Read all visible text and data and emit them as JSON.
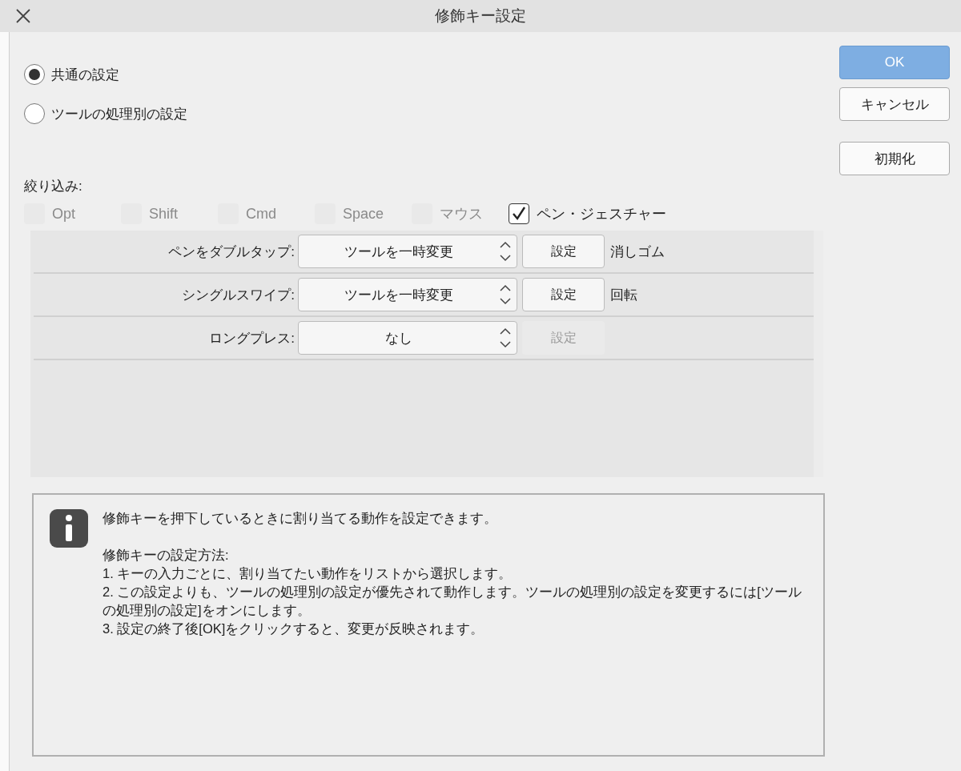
{
  "window": {
    "title": "修飾キー設定"
  },
  "modes": [
    {
      "label": "共通の設定",
      "selected": true
    },
    {
      "label": "ツールの処理別の設定",
      "selected": false
    }
  ],
  "filter_label": "絞り込み:",
  "filters": [
    {
      "label": "Opt",
      "checked": false,
      "disabled": true
    },
    {
      "label": "Shift",
      "checked": false,
      "disabled": true
    },
    {
      "label": "Cmd",
      "checked": false,
      "disabled": true
    },
    {
      "label": "Space",
      "checked": false,
      "disabled": true
    },
    {
      "label": "マウス",
      "checked": false,
      "disabled": true
    },
    {
      "label": "ペン・ジェスチャー",
      "checked": true,
      "disabled": false
    }
  ],
  "rows": [
    {
      "label": "ペンをダブルタップ:",
      "action": "ツールを一時変更",
      "button": "設定",
      "button_disabled": false,
      "result": "消しゴム"
    },
    {
      "label": "シングルスワイプ:",
      "action": "ツールを一時変更",
      "button": "設定",
      "button_disabled": false,
      "result": "回転"
    },
    {
      "label": "ロングプレス:",
      "action": "なし",
      "button": "設定",
      "button_disabled": true
    }
  ],
  "info": [
    "修飾キーを押下しているときに割り当てる動作を設定できます。",
    "修飾キーの設定方法:",
    "1. キーの入力ごとに、割り当てたい動作をリストから選択します。",
    "2. この設定よりも、ツールの処理別の設定が優先されて動作します。ツールの処理別の設定を変更するには[ツールの処理別の設定]をオンにします。",
    "3. 設定の終了後[OK]をクリックすると、変更が反映されます。"
  ],
  "buttons": [
    {
      "label": "OK",
      "primary": true
    },
    {
      "label": "キャンセル",
      "primary": false
    },
    {
      "label": "初期化",
      "primary": false
    }
  ]
}
